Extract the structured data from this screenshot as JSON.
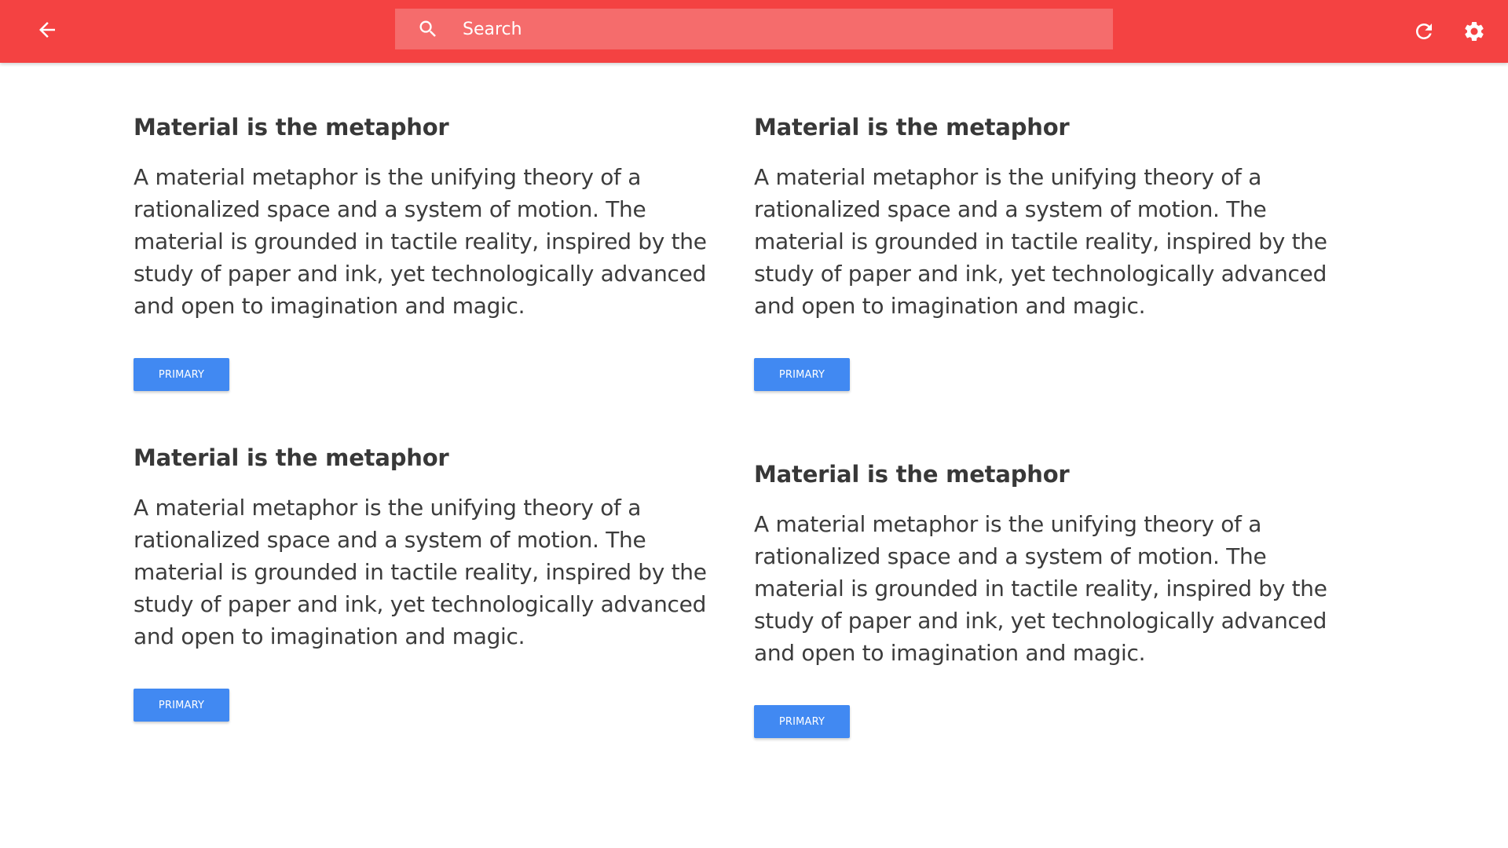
{
  "app_bar": {
    "background_color": "#f44242",
    "back_icon": "arrow-left-icon",
    "refresh_icon": "refresh-icon",
    "settings_icon": "gear-icon",
    "search": {
      "icon": "search-icon",
      "placeholder": "Search",
      "value": ""
    }
  },
  "cards": [
    {
      "title": "Material is the metaphor",
      "body": "A material metaphor is the unifying theory of a rationalized space and a system of motion. The material is grounded in tactile reality, inspired by the study of paper and ink, yet technologically advanced and open to imagination and magic.",
      "button_label": "PRIMARY"
    },
    {
      "title": "Material is the metaphor",
      "body": "A material metaphor is the unifying theory of a rationalized space and a system of motion. The material is grounded in tactile reality, inspired by the study of paper and ink, yet technologically advanced and open to imagination and magic.",
      "button_label": "PRIMARY"
    },
    {
      "title": "Material is the metaphor",
      "body": "A material metaphor is the unifying theory of a rationalized space and a system of motion. The material is grounded in tactile reality, inspired by the study of paper and ink, yet technologically advanced and open to imagination and magic.",
      "button_label": "PRIMARY"
    },
    {
      "title": "Material is the metaphor",
      "body": "A material metaphor is the unifying theory of a rationalized space and a system of motion. The material is grounded in tactile reality, inspired by the study of paper and ink, yet technologically advanced and open to imagination and magic.",
      "button_label": "PRIMARY"
    }
  ],
  "colors": {
    "primary_button": "#4189f2",
    "search_background": "#f56c6c"
  }
}
